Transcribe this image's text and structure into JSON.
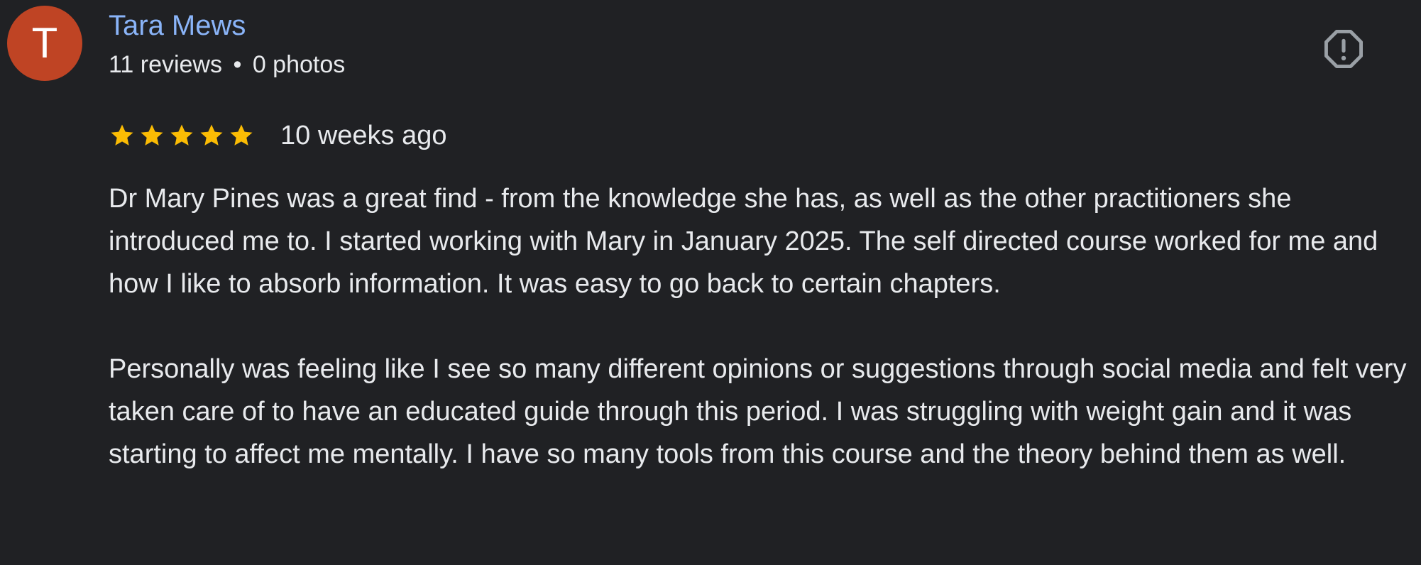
{
  "review": {
    "avatar_letter": "T",
    "author_name": "Tara Mews",
    "reviews_count": "11 reviews",
    "separator": "•",
    "photos_count": "0 photos",
    "rating": 5,
    "rating_max": 5,
    "time_ago": "10 weeks ago",
    "paragraphs": [
      "Dr Mary Pines was a great find - from the knowledge she has, as well as the other practitioners she introduced me to. I started working with Mary in January 2025. The self directed course worked for me and how I like to absorb information. It was easy to go back to certain chapters.",
      "Personally was feeling like I see so many different opinions or suggestions through social media and felt very taken care of to have an educated guide through this period. I was struggling with weight gain and it was starting to affect me mentally. I have so many tools from this course and the theory behind them as well."
    ]
  },
  "icons": {
    "report": "report-octagon-icon",
    "star": "star-icon"
  },
  "colors": {
    "background": "#202124",
    "author": "#8ab4f8",
    "avatar": "#bf4424",
    "star": "#fbbc04",
    "text": "#e8eaed"
  }
}
